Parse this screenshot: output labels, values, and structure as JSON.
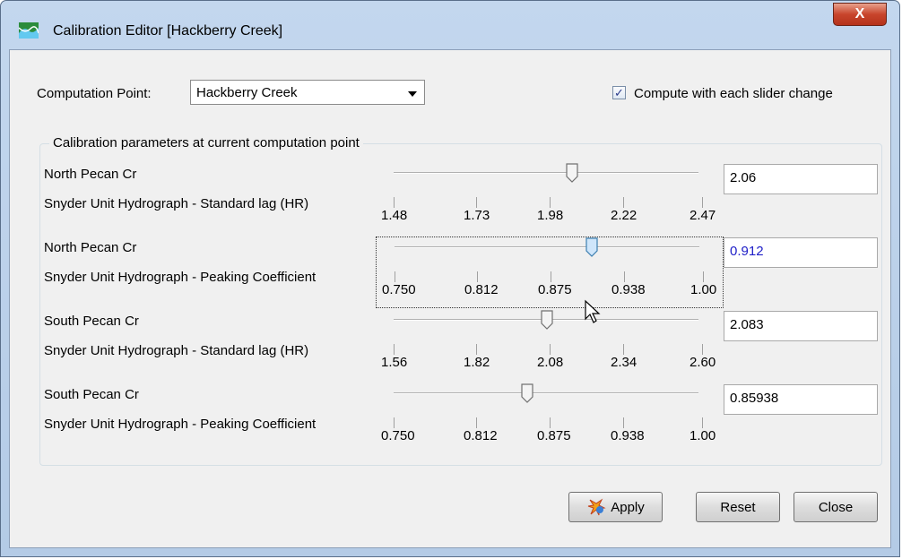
{
  "window": {
    "title": "Calibration Editor [Hackberry Creek]",
    "icon": "calibration-app-icon",
    "close_glyph": "X"
  },
  "computation_point": {
    "label": "Computation Point:",
    "value": "Hackberry Creek"
  },
  "compute_each_change": {
    "label": "Compute with each slider change",
    "checked": true,
    "check_glyph": "✓"
  },
  "parameters": {
    "group_title": "Calibration parameters at current computation point",
    "items": [
      {
        "name": "North Pecan Cr",
        "description": "Snyder Unit Hydrograph - Standard lag (HR)",
        "ticks": [
          "1.48",
          "1.73",
          "1.98",
          "2.22",
          "2.47"
        ],
        "min": 1.48,
        "max": 2.47,
        "current": 2.06,
        "value": "2.06",
        "focused": false
      },
      {
        "name": "North Pecan Cr",
        "description": "Snyder Unit Hydrograph - Peaking Coefficient",
        "ticks": [
          "0.750",
          "0.812",
          "0.875",
          "0.938",
          "1.00"
        ],
        "min": 0.75,
        "max": 1.0,
        "current": 0.912,
        "value": "0.912",
        "focused": true
      },
      {
        "name": "South Pecan Cr",
        "description": "Snyder Unit Hydrograph - Standard lag (HR)",
        "ticks": [
          "1.56",
          "1.82",
          "2.08",
          "2.34",
          "2.60"
        ],
        "min": 1.56,
        "max": 2.6,
        "current": 2.083,
        "value": "2.083",
        "focused": false
      },
      {
        "name": "South Pecan Cr",
        "description": "Snyder Unit Hydrograph - Peaking Coefficient",
        "ticks": [
          "0.750",
          "0.812",
          "0.875",
          "0.938",
          "1.00"
        ],
        "min": 0.75,
        "max": 1.0,
        "current": 0.85938,
        "value": "0.85938",
        "focused": false
      }
    ]
  },
  "buttons": {
    "apply": "Apply",
    "reset": "Reset",
    "close": "Close"
  },
  "colors": {
    "title_bar": "#b9cfe8",
    "close_button": "#c8452c",
    "active_value_text": "#2020c8"
  }
}
